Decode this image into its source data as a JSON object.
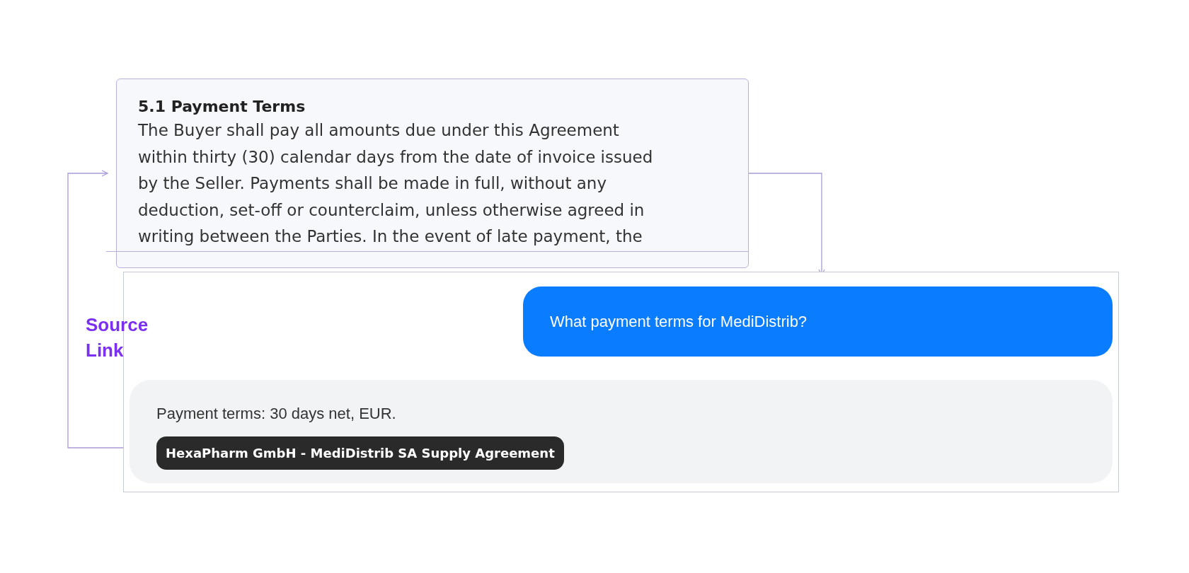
{
  "document_excerpt": {
    "heading": "5.1 Payment Terms",
    "lines": [
      "The Buyer shall pay all amounts due under this Agreement",
      "within thirty (30) calendar days from the date of invoice issued",
      "by the Seller. Payments shall be made in full, without any",
      "deduction, set-off or counterclaim, unless otherwise agreed in",
      "writing between the Parties. In the event of late payment, the"
    ]
  },
  "annotation": {
    "label": "Source Link"
  },
  "chat": {
    "messages": [
      {
        "kind": "user",
        "text": "What payment terms for MediDistrib?"
      },
      {
        "kind": "assistant",
        "text": "Payment terms: 30 days net, EUR.",
        "source": "HexaPharm GmbH - MediDistrib SA Supply Agreement"
      }
    ]
  }
}
